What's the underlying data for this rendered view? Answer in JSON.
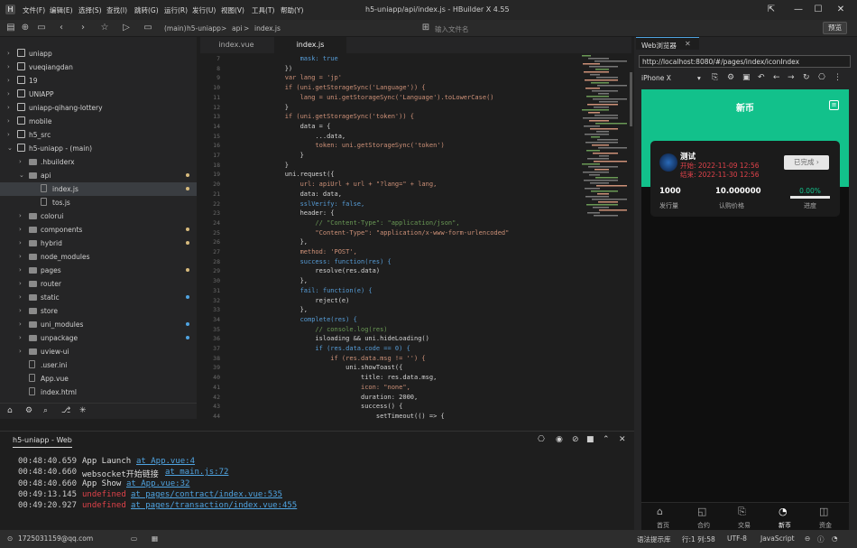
{
  "window": {
    "title": "h5-uniapp/api/index.js - HBuilder X 4.55",
    "icon_label": "H"
  },
  "menu": [
    "文件(F)",
    "编辑(E)",
    "选择(S)",
    "查找(I)",
    "跳转(G)",
    "运行(R)",
    "发行(U)",
    "视图(V)",
    "工具(T)",
    "帮助(Y)"
  ],
  "toolbar": {
    "breadcrumb": [
      "(main)",
      "h5-uniapp",
      ">",
      "api",
      ">",
      "index.js"
    ],
    "search_placeholder": "输入文件名",
    "preview_label": "预览"
  },
  "sidebar": {
    "items": [
      {
        "label": "uniapp",
        "level": 0,
        "arrow": "›",
        "icon": "project",
        "dot": ""
      },
      {
        "label": "vueqiangdan",
        "level": 0,
        "arrow": "›",
        "icon": "project",
        "dot": ""
      },
      {
        "label": "19",
        "level": 0,
        "arrow": "›",
        "icon": "project",
        "dot": ""
      },
      {
        "label": "UNIAPP",
        "level": 0,
        "arrow": "›",
        "icon": "project",
        "dot": ""
      },
      {
        "label": "uniapp-qihang-lottery",
        "level": 0,
        "arrow": "›",
        "icon": "project",
        "dot": ""
      },
      {
        "label": "mobile",
        "level": 0,
        "arrow": "›",
        "icon": "project",
        "dot": ""
      },
      {
        "label": "h5_src",
        "level": 0,
        "arrow": "›",
        "icon": "project",
        "dot": ""
      },
      {
        "label": "h5-uniapp - (main)",
        "level": 0,
        "arrow": "⌄",
        "icon": "project",
        "dot": ""
      },
      {
        "label": ".hbuilderx",
        "level": 1,
        "arrow": "›",
        "icon": "folder",
        "dot": ""
      },
      {
        "label": "api",
        "level": 1,
        "arrow": "⌄",
        "icon": "folder",
        "dot": "#d7ba7d"
      },
      {
        "label": "index.js",
        "level": 2,
        "arrow": "",
        "icon": "file",
        "dot": "#d7ba7d",
        "selected": true
      },
      {
        "label": "tos.js",
        "level": 2,
        "arrow": "",
        "icon": "file",
        "dot": ""
      },
      {
        "label": "colorui",
        "level": 1,
        "arrow": "›",
        "icon": "folder",
        "dot": ""
      },
      {
        "label": "components",
        "level": 1,
        "arrow": "›",
        "icon": "folder",
        "dot": "#d7ba7d"
      },
      {
        "label": "hybrid",
        "level": 1,
        "arrow": "›",
        "icon": "folder",
        "dot": "#d7ba7d"
      },
      {
        "label": "node_modules",
        "level": 1,
        "arrow": "›",
        "icon": "folder",
        "dot": ""
      },
      {
        "label": "pages",
        "level": 1,
        "arrow": "›",
        "icon": "folder",
        "dot": "#d7ba7d"
      },
      {
        "label": "router",
        "level": 1,
        "arrow": "›",
        "icon": "folder",
        "dot": ""
      },
      {
        "label": "static",
        "level": 1,
        "arrow": "›",
        "icon": "folder",
        "dot": "#4fa3e0"
      },
      {
        "label": "store",
        "level": 1,
        "arrow": "›",
        "icon": "folder",
        "dot": ""
      },
      {
        "label": "uni_modules",
        "level": 1,
        "arrow": "›",
        "icon": "folder",
        "dot": "#4fa3e0"
      },
      {
        "label": "unpackage",
        "level": 1,
        "arrow": "›",
        "icon": "folder",
        "dot": "#4fa3e0"
      },
      {
        "label": "uview-ui",
        "level": 1,
        "arrow": "›",
        "icon": "folder",
        "dot": ""
      },
      {
        "label": ".user.ini",
        "level": 1,
        "arrow": "",
        "icon": "file",
        "dot": ""
      },
      {
        "label": "App.vue",
        "level": 1,
        "arrow": "",
        "icon": "file",
        "dot": ""
      },
      {
        "label": "index.html",
        "level": 1,
        "arrow": "",
        "icon": "file",
        "dot": ""
      }
    ]
  },
  "editor": {
    "tabs": [
      "index.vue",
      "index.js"
    ],
    "lines": [
      {
        "n": "7",
        "t": "            mask: true"
      },
      {
        "n": "8",
        "t": "        })"
      },
      {
        "n": "9",
        "t": "        var lang = 'jp'"
      },
      {
        "n": "10",
        "t": "        if (uni.getStorageSync('Language')) {"
      },
      {
        "n": "11",
        "t": "            lang = uni.getStorageSync('Language').toLowerCase()"
      },
      {
        "n": "12",
        "t": "        }"
      },
      {
        "n": "13",
        "t": "        if (uni.getStorageSync('token')) {"
      },
      {
        "n": "14",
        "t": "            data = {"
      },
      {
        "n": "15",
        "t": "                ...data,"
      },
      {
        "n": "16",
        "t": "                token: uni.getStorageSync('token')"
      },
      {
        "n": "17",
        "t": "            }"
      },
      {
        "n": "18",
        "t": "        }"
      },
      {
        "n": "19",
        "t": "        uni.request({"
      },
      {
        "n": "20",
        "t": "            url: apiUrl + url + \"?lang=\" + lang,"
      },
      {
        "n": "21",
        "t": "            data: data,"
      },
      {
        "n": "22",
        "t": "            sslVerify: false,"
      },
      {
        "n": "23",
        "t": "            header: {"
      },
      {
        "n": "24",
        "t": "                // \"Content-Type\": \"application/json\","
      },
      {
        "n": "25",
        "t": "                \"Content-Type\": \"application/x-www-form-urlencoded\""
      },
      {
        "n": "26",
        "t": "            },"
      },
      {
        "n": "27",
        "t": "            method: 'POST',"
      },
      {
        "n": "28",
        "t": "            success: function(res) {"
      },
      {
        "n": "29",
        "t": "                resolve(res.data)"
      },
      {
        "n": "30",
        "t": "            },"
      },
      {
        "n": "31",
        "t": "            fail: function(e) {"
      },
      {
        "n": "32",
        "t": "                reject(e)"
      },
      {
        "n": "33",
        "t": "            },"
      },
      {
        "n": "34",
        "t": "            complete(res) {"
      },
      {
        "n": "35",
        "t": "                // console.log(res)"
      },
      {
        "n": "36",
        "t": "                isloading && uni.hideLoading()"
      },
      {
        "n": "37",
        "t": "                if (res.data.code == 0) {"
      },
      {
        "n": "38",
        "t": "                    if (res.data.msg != '') {"
      },
      {
        "n": "39",
        "t": "                        uni.showToast({"
      },
      {
        "n": "40",
        "t": "                            title: res.data.msg,"
      },
      {
        "n": "41",
        "t": "                            icon: \"none\","
      },
      {
        "n": "42",
        "t": "                            duration: 2000,"
      },
      {
        "n": "43",
        "t": "                            success() {"
      },
      {
        "n": "44",
        "t": "                                setTimeout(() => {"
      }
    ]
  },
  "browser": {
    "tab_title": "Web浏览器",
    "url": "http://localhost:8080/#/pages/index/iconIndex",
    "device": "iPhone X",
    "page_title": "新币",
    "card": {
      "name": "测试",
      "start_label": "开始: 2022-11-09 12:56",
      "end_label": "结束: 2022-11-30 12:56",
      "button": "已完成 ›",
      "stats": [
        {
          "value": "1000",
          "label": "发行量"
        },
        {
          "value": "10.000000",
          "label": "认购价格"
        },
        {
          "value": "0.00%",
          "label": "进度"
        }
      ],
      "progress": 0
    },
    "nav": [
      "首页",
      "合约",
      "交易",
      "新币",
      "资金"
    ],
    "nav_active": 3,
    "accent": "#12c18b"
  },
  "console": {
    "tab": "h5-uniapp - Web",
    "logs": [
      {
        "time": "00:48:40.659",
        "msg": "App Launch",
        "link": "at App.vue:4",
        "error": false
      },
      {
        "time": "00:48:40.660",
        "msg": "websocket开始链接",
        "link": "at main.js:72",
        "error": false
      },
      {
        "time": "00:48:40.660",
        "msg": "App Show",
        "link": "at App.vue:32",
        "error": false
      },
      {
        "time": "00:49:13.145",
        "msg": "undefined",
        "link": "at pages/contract/index.vue:535",
        "error": true
      },
      {
        "time": "00:49:20.927",
        "msg": "undefined",
        "link": "at pages/transaction/index.vue:455",
        "error": true
      }
    ]
  },
  "status": {
    "user": "1725031159@qq.com",
    "hint": "语法提示库",
    "position": "行:1  列:58",
    "encoding": "UTF-8",
    "language": "JavaScript"
  }
}
